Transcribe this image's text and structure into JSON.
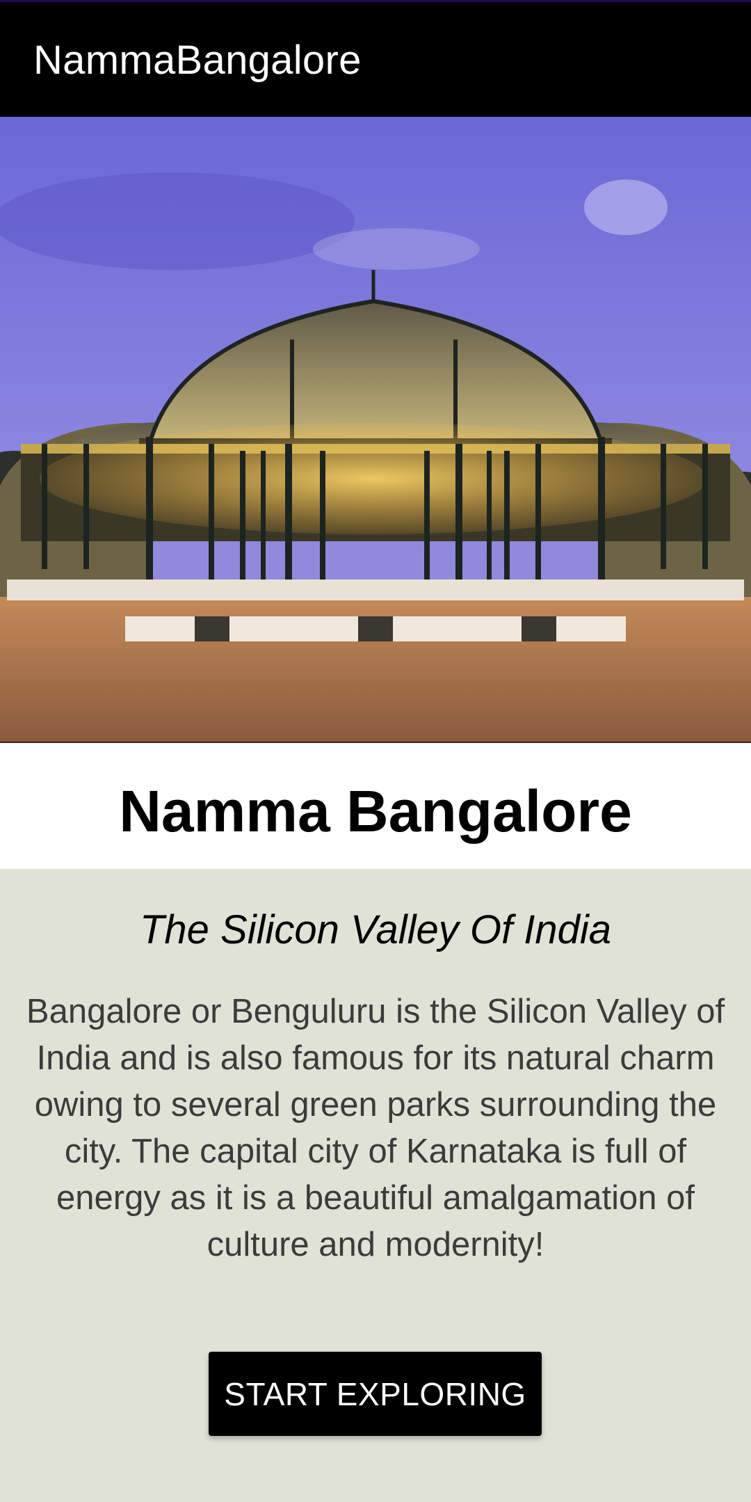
{
  "app_bar": {
    "title": "NammaBangalore"
  },
  "hero": {
    "alt": "Glass House at Lalbagh, Bangalore at dusk"
  },
  "main": {
    "title": "Namma Bangalore",
    "subtitle": "The Silicon Valley Of India",
    "description": "Bangalore or Benguluru is the Silicon Valley of India and is also famous for its natural charm owing to several green parks surrounding the city. The capital city of Karnataka is full of energy as it is a beautiful amalgamation of culture and modernity!",
    "cta_label": "START EXPLORING"
  },
  "colors": {
    "app_bar": "#000000",
    "content_background": "#e1e2d6",
    "button": "#000000",
    "button_text": "#ffffff"
  }
}
